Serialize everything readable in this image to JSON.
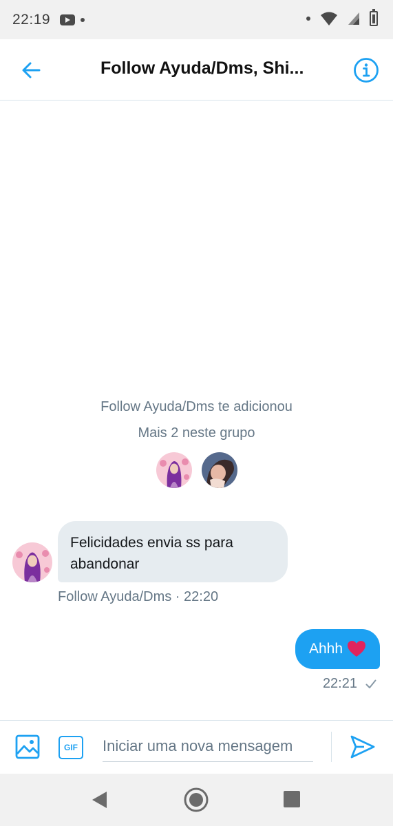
{
  "status_bar": {
    "time": "22:19"
  },
  "header": {
    "title": "Follow Ayuda/Dms, Shi..."
  },
  "conversation": {
    "system_added": "Follow Ayuda/Dms te adicionou",
    "system_members": "Mais 2 neste grupo",
    "incoming": {
      "text_line1": "Felicidades envia ss para",
      "text_line2": "abandonar",
      "meta": "Follow Ayuda/Dms · 22:20"
    },
    "outgoing": {
      "text": "Ahhh",
      "time": "22:21"
    }
  },
  "composer": {
    "placeholder": "Iniciar uma nova mensagem",
    "gif_label": "GIF"
  },
  "colors": {
    "accent": "#1da1f2",
    "incoming_bubble": "#e6ecf0",
    "secondary_text": "#657786",
    "heart": "#e0245e"
  }
}
